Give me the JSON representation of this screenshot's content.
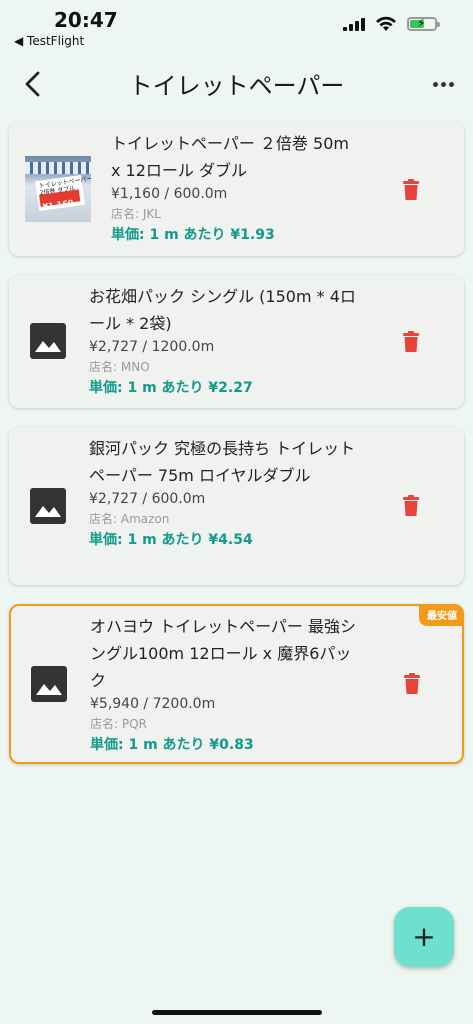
{
  "status_bar": {
    "time": "20:47",
    "back_app": "◀ TestFlight"
  },
  "header": {
    "title": "トイレットペーパー"
  },
  "items": [
    {
      "name": "トイレットペーパー ２倍巻 50m x 12ロール ダブル",
      "price": "¥1,160 / 600.0m",
      "store": "店名: JKL",
      "unit_price": "単価: 1 m あたり ¥1.93",
      "image": "product-photo",
      "photo_text": "トイレットペーパー\n2倍巻 ダブル",
      "photo_price": "¥1,160",
      "best": false
    },
    {
      "name": "お花畑パック シングル (150m * 4ロール * 2袋)",
      "price": "¥2,727 / 1200.0m",
      "store": "店名: MNO",
      "unit_price": "単価: 1 m あたり ¥2.27",
      "image": "image-placeholder-icon",
      "best": false
    },
    {
      "name": "銀河パック 究極の長持ち トイレットペーパー 75m ロイヤルダブル",
      "price": "¥2,727 / 600.0m",
      "store": "店名: Amazon",
      "unit_price": "単価: 1 m あたり ¥4.54",
      "image": "image-placeholder-icon",
      "best": false
    },
    {
      "name": "オハヨウ トイレットペーパー 最強シングル100m 12ロール x 魔界6パック",
      "price": "¥5,940 / 7200.0m",
      "store": "店名: PQR",
      "unit_price": "単価: 1 m あたり ¥0.83",
      "image": "image-placeholder-icon",
      "best": true,
      "badge": "最安値"
    }
  ],
  "fab": {
    "label": "+"
  },
  "colors": {
    "background": "#eef6f2",
    "card": "#f0f2f0",
    "accent_text": "#129a8a",
    "best_border": "#f29a1a",
    "delete": "#e8433a",
    "fab": "#6ee0cd"
  }
}
